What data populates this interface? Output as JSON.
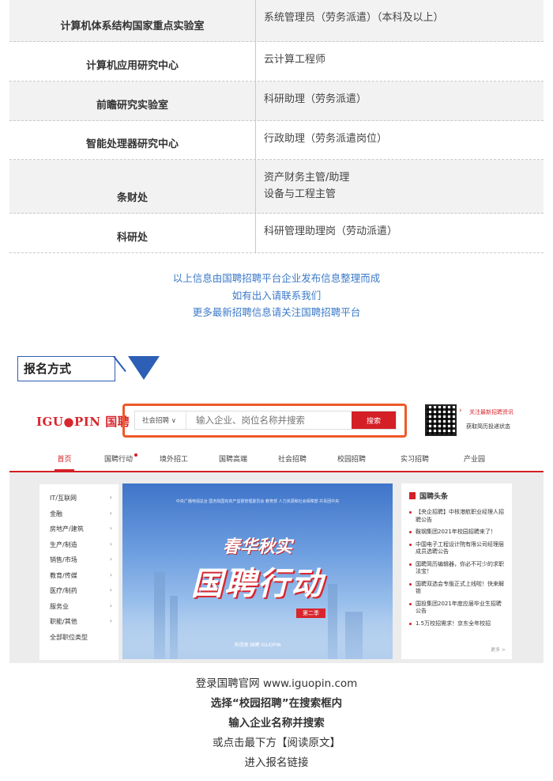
{
  "jobs": [
    {
      "dept": "计算机体系结构国家重点实验室",
      "positions": [
        "系统管理员（劳务派遣）（本科及以上）"
      ]
    },
    {
      "dept": "计算机应用研究中心",
      "positions": [
        "云计算工程师"
      ]
    },
    {
      "dept": "前瞻研究实验室",
      "positions": [
        "科研助理（劳务派遣）"
      ]
    },
    {
      "dept": "智能处理器研究中心",
      "positions": [
        "行政助理（劳务派遣岗位）"
      ]
    },
    {
      "dept": "条财处",
      "positions": [
        "资产财务主管/助理",
        "设备与工程主管"
      ]
    },
    {
      "dept": "科研处",
      "positions": [
        "科研管理助理岗（劳动派遣）"
      ]
    }
  ],
  "note": {
    "line1": "以上信息由国聘招聘平台企业发布信息整理而成",
    "line2": "如有出入请联系我们",
    "line3": "更多最新招聘信息请关注国聘招聘平台"
  },
  "section": {
    "title": "报名方式"
  },
  "site": {
    "logo": "IGU●PIN 国聘",
    "search_select": "社会招聘 ∨",
    "search_placeholder": "输入企业、岗位名称并搜索",
    "search_button": "搜索",
    "qr_text1": "关注最新招聘资讯",
    "qr_text2": "获取简历投递状态",
    "nav": [
      "首页",
      "国聘行动",
      "境外招工",
      "国聘高端",
      "社会招聘",
      "校园招聘",
      "实习招聘",
      "产业园"
    ],
    "categories": [
      "IT/互联网",
      "金融",
      "房地产/建筑",
      "生产/制造",
      "销售/市场",
      "教育/传媒",
      "医疗/制药",
      "服务业",
      "职能/其他",
      "全部职位类型"
    ],
    "banner": {
      "top": "中央广播电视总台   国务院国有资产监督管理委员会   教育部   人力资源和社会保障部   共青团中央",
      "sub": "春华秋实",
      "main": "国聘行动",
      "tag": "第二季",
      "logos": "央视频    国聘 IGUOPIN"
    },
    "news_title": "国聘头条",
    "news": [
      "【央企招聘】中核港航职业经理人招聘公告",
      "鞍钢集团2021年校园招聘来了！",
      "中国电子工程设计院有限公司经理层成员选聘公告",
      "国聘简历编辑器，你必不可少的求职法宝！",
      "国聘双选会专版正式上线啦！快来解锁",
      "国投集团2021年度应届毕业生招聘公告",
      "1.5万校招需求！京东全年校招"
    ],
    "news_more": "更多 >"
  },
  "instructions": {
    "line1": "登录国聘官网 www.iguopin.com",
    "line2": "选择“校园招聘”在搜索框内",
    "line3": "输入企业名称并搜索",
    "line4": "或点击最下方【阅读原文】",
    "line5": "进入报名链接"
  }
}
